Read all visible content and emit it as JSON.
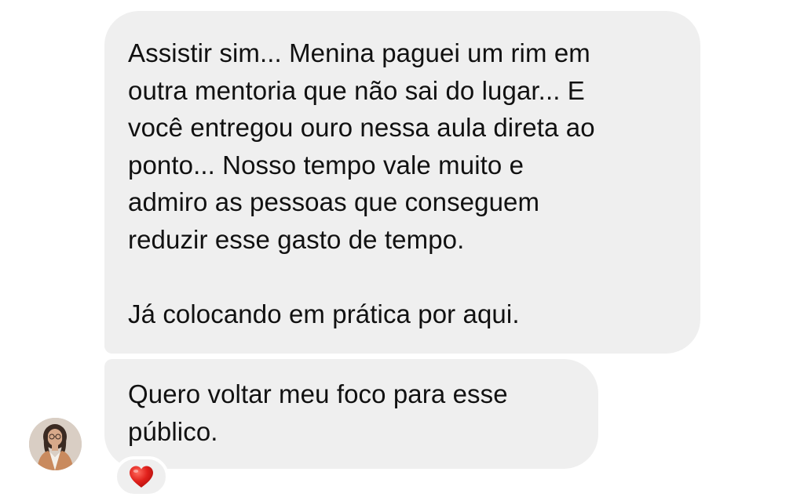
{
  "thread": {
    "messages": [
      {
        "lines": [
          "Assistir sim... Menina paguei um rim em",
          "outra mentoria que não sai do lugar... E",
          "você entregou ouro nessa aula direta ao",
          "ponto... Nosso tempo vale muito e",
          "admiro as pessoas que conseguem",
          "reduzir esse gasto de tempo.",
          "",
          "Já colocando em prática por aqui."
        ]
      },
      {
        "lines": [
          "Quero voltar meu foco para esse",
          "público."
        ],
        "reaction": {
          "emoji": "heart-icon",
          "color": "#e0201b"
        }
      }
    ],
    "sender_avatar": "avatar-photo",
    "bubble_color": "#efefef"
  }
}
